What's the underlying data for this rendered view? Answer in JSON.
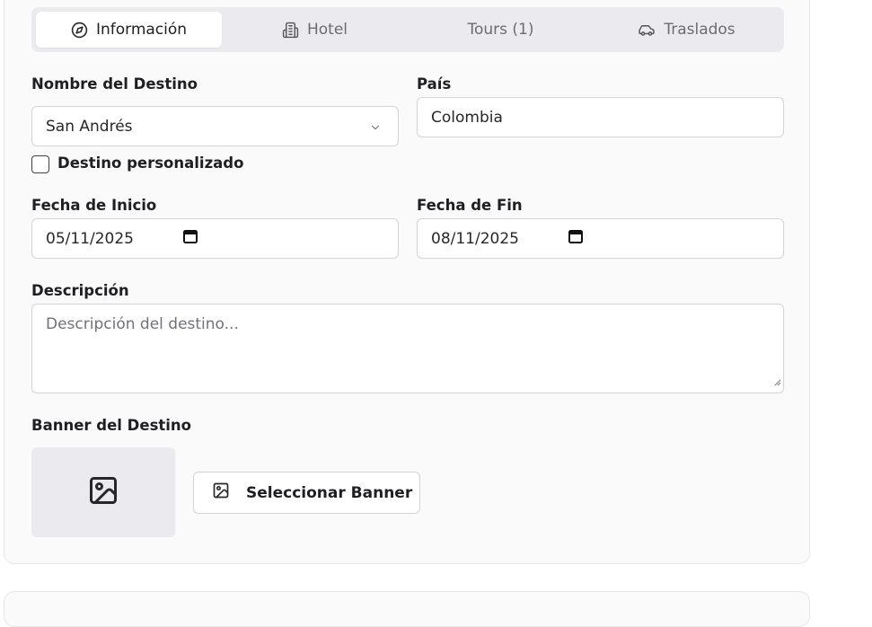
{
  "tabs": [
    {
      "label": "Información",
      "icon": "compass-icon",
      "active": true
    },
    {
      "label": "Hotel",
      "icon": "building-icon",
      "active": false
    },
    {
      "label": "Tours (1)",
      "icon": "",
      "active": false
    },
    {
      "label": "Traslados",
      "icon": "car-icon",
      "active": false
    }
  ],
  "form": {
    "destination_label": "Nombre del Destino",
    "destination_value": "San Andrés",
    "country_label": "País",
    "country_value": "Colombia",
    "custom_destination_label": "Destino personalizado",
    "custom_destination_checked": false,
    "start_date_label": "Fecha de Inicio",
    "start_date_value": "05/11/2025",
    "end_date_label": "Fecha de Fin",
    "end_date_value": "08/11/2025",
    "description_label": "Descripción",
    "description_placeholder": "Descripción del destino...",
    "banner_label": "Banner del Destino",
    "banner_button": "Seleccionar Banner"
  },
  "colors": {
    "active_tab_bg": "#ffffff",
    "tabs_bg": "#ebebef",
    "card_bg": "#fafafa"
  }
}
